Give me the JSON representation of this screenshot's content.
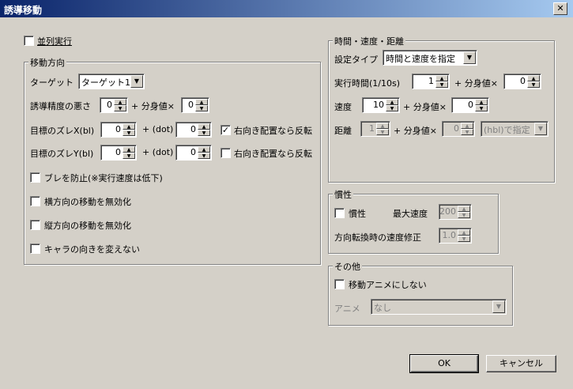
{
  "window": {
    "title": "誘導移動",
    "close_glyph": "✕"
  },
  "parallel": {
    "label": "並列実行",
    "checked": false
  },
  "move_direction": {
    "title": "移動方向",
    "target_label": "ターゲット",
    "target_value": "ターゲット1",
    "accuracy_label": "誘導精度の悪さ",
    "accuracy_value": "0",
    "plus_bunshin": "+ 分身値×",
    "accuracy_bunshin": "0",
    "offset_x_label": "目標のズレX(bl)",
    "offset_x_value": "0",
    "plus_dot": "+ (dot)",
    "offset_x_dot": "0",
    "flip_x_label": "右向き配置なら反転",
    "flip_x_checked": true,
    "offset_y_label": "目標のズレY(bl)",
    "offset_y_value": "0",
    "offset_y_dot": "0",
    "flip_y_label": "右向き配置なら反転",
    "flip_y_checked": false,
    "options": [
      {
        "label": "ブレを防止(※実行速度は低下)",
        "checked": false
      },
      {
        "label": "横方向の移動を無効化",
        "checked": false
      },
      {
        "label": "縦方向の移動を無効化",
        "checked": false
      },
      {
        "label": "キャラの向きを変えない",
        "checked": false
      }
    ]
  },
  "time_speed": {
    "title": "時間・速度・距離",
    "type_label": "設定タイプ",
    "type_value": "時間と速度を指定",
    "exec_time_label": "実行時間(1/10s)",
    "exec_time_value": "1",
    "plus_bunshin": "+ 分身値×",
    "exec_time_bunshin": "0",
    "speed_label": "速度",
    "speed_value": "10",
    "speed_bunshin": "0",
    "distance_label": "距離",
    "distance_value": "1",
    "distance_bunshin": "0",
    "distance_unit": "(hbl)で指定"
  },
  "inertia": {
    "title": "慣性",
    "checkbox_label": "慣性",
    "checked": false,
    "max_speed_label": "最大速度",
    "max_speed_value": "200",
    "turn_label": "方向転換時の速度修正",
    "turn_value": "1.0"
  },
  "other": {
    "title": "その他",
    "no_anim_label": "移動アニメにしない",
    "no_anim_checked": false,
    "anime_label": "アニメ",
    "anime_value": "なし"
  },
  "buttons": {
    "ok": "OK",
    "cancel": "キャンセル"
  }
}
